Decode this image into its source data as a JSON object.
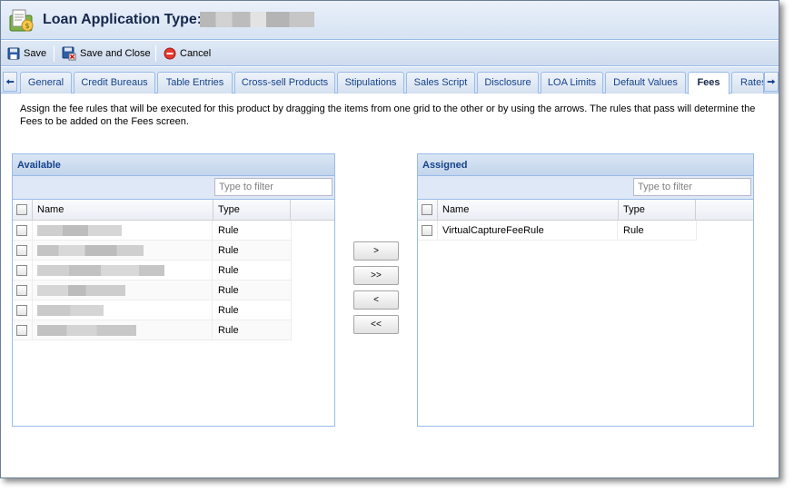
{
  "header": {
    "title": "Loan Application Type:",
    "icon": "loan-application-icon"
  },
  "toolbar": {
    "save_label": "Save",
    "save_and_close_label": "Save and Close",
    "cancel_label": "Cancel"
  },
  "tabs": [
    {
      "label": "General"
    },
    {
      "label": "Credit Bureaus"
    },
    {
      "label": "Table Entries"
    },
    {
      "label": "Cross-sell Products"
    },
    {
      "label": "Stipulations"
    },
    {
      "label": "Sales Script"
    },
    {
      "label": "Disclosure"
    },
    {
      "label": "LOA Limits"
    },
    {
      "label": "Default Values"
    },
    {
      "label": "Fees",
      "active": true
    },
    {
      "label": "Rates"
    }
  ],
  "instructions": "Assign the fee rules that will be executed for this product by dragging the items from one grid to the other or by using the arrows. The rules that pass will determine the Fees to be added on the Fees screen.",
  "available": {
    "title": "Available",
    "filter_placeholder": "Type to filter",
    "columns": {
      "name": "Name",
      "type": "Type"
    },
    "rows": [
      {
        "type": "Rule"
      },
      {
        "type": "Rule"
      },
      {
        "type": "Rule"
      },
      {
        "type": "Rule"
      },
      {
        "type": "Rule"
      },
      {
        "type": "Rule"
      }
    ]
  },
  "assigned": {
    "title": "Assigned",
    "filter_placeholder": "Type to filter",
    "columns": {
      "name": "Name",
      "type": "Type"
    },
    "rows": [
      {
        "name": "VirtualCaptureFeeRule",
        "type": "Rule"
      }
    ]
  },
  "transfer": {
    "move_selected": ">",
    "move_all": ">>",
    "remove_selected": "<",
    "remove_all": "<<"
  },
  "colors": {
    "accent": "#15428b",
    "panel_border": "#99bbe8",
    "header_bg": "#dae6f4"
  }
}
